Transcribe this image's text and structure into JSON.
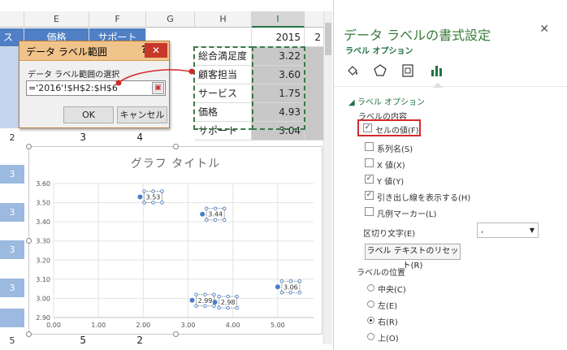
{
  "sheet": {
    "col_e": "E",
    "col_f": "F",
    "col_g": "G",
    "col_h": "H",
    "col_i": "I",
    "hdr_e_cut": "価格",
    "hdr_f_cut": "サポート",
    "hdr_left_cut": "ス",
    "year": "2015",
    "year_cut": "2",
    "rows": [
      {
        "label": "総合満足度",
        "value": "3.22"
      },
      {
        "label": "顧客担当",
        "value": "3.60"
      },
      {
        "label": "サービス",
        "value": "1.75"
      },
      {
        "label": "価格",
        "value": "4.93"
      },
      {
        "label": "サポート",
        "value": "3.04"
      }
    ],
    "row7": {
      "a": "2",
      "b": "3",
      "c": "4"
    },
    "row_hdrs": [
      "3",
      "3",
      "3",
      "3"
    ],
    "row_bottom": {
      "a": "5",
      "b": "5",
      "c": "2"
    }
  },
  "dialog": {
    "title": "データ ラベル範囲",
    "help": "?",
    "close": "✕",
    "label": "データ ラベル範囲の選択",
    "value": "='2016'!$H$2:$H$6",
    "ok": "OK",
    "cancel": "キャンセル"
  },
  "chart_data": {
    "type": "scatter",
    "title": "グラフ タイトル",
    "x_ticks": [
      "0.00",
      "1.00",
      "2.00",
      "3.00",
      "4.00",
      "5.00"
    ],
    "y_ticks": [
      "2.90",
      "3.00",
      "3.10",
      "3.20",
      "3.30",
      "3.40",
      "3.50",
      "3.60"
    ],
    "xlim": [
      0,
      5.8
    ],
    "ylim": [
      2.9,
      3.6
    ],
    "points": [
      {
        "x": 1.93,
        "y": 3.53,
        "label": "3.53"
      },
      {
        "x": 3.32,
        "y": 3.44,
        "label": "3.44"
      },
      {
        "x": 3.09,
        "y": 2.99,
        "label": "2.99"
      },
      {
        "x": 3.6,
        "y": 2.98,
        "label": "2.98"
      },
      {
        "x": 5.0,
        "y": 3.06,
        "label": "3.06"
      }
    ],
    "point_color": "#4a7fc6",
    "grid": true
  },
  "pane": {
    "title": "データ ラベルの書式設定",
    "close": "✕",
    "tab": "ラベル オプション",
    "icons": [
      "paint-bucket-icon",
      "pentagon-icon",
      "size-properties-icon",
      "bar-chart-icon"
    ],
    "section": "ラベル オプション",
    "contents_label": "ラベルの内容",
    "checks": [
      {
        "label": "セルの値(F)",
        "checked": true
      },
      {
        "label": "系列名(S)",
        "checked": false
      },
      {
        "label": "X 値(X)",
        "checked": false
      },
      {
        "label": "Y 値(Y)",
        "checked": true
      },
      {
        "label": "引き出し線を表示する(H)",
        "checked": true
      },
      {
        "label": "凡例マーカー(L)",
        "checked": false
      }
    ],
    "separator_label": "区切り文字(E)",
    "separator_value": ",",
    "reset_button": "ラベル テキストのリセット(R)",
    "position_label": "ラベルの位置",
    "positions": [
      {
        "label": "中央(C)",
        "selected": false
      },
      {
        "label": "左(E)",
        "selected": false
      },
      {
        "label": "右(R)",
        "selected": true
      },
      {
        "label": "上(O)",
        "selected": false
      }
    ],
    "accent": "#217346",
    "highlight": "#d42a2a"
  }
}
